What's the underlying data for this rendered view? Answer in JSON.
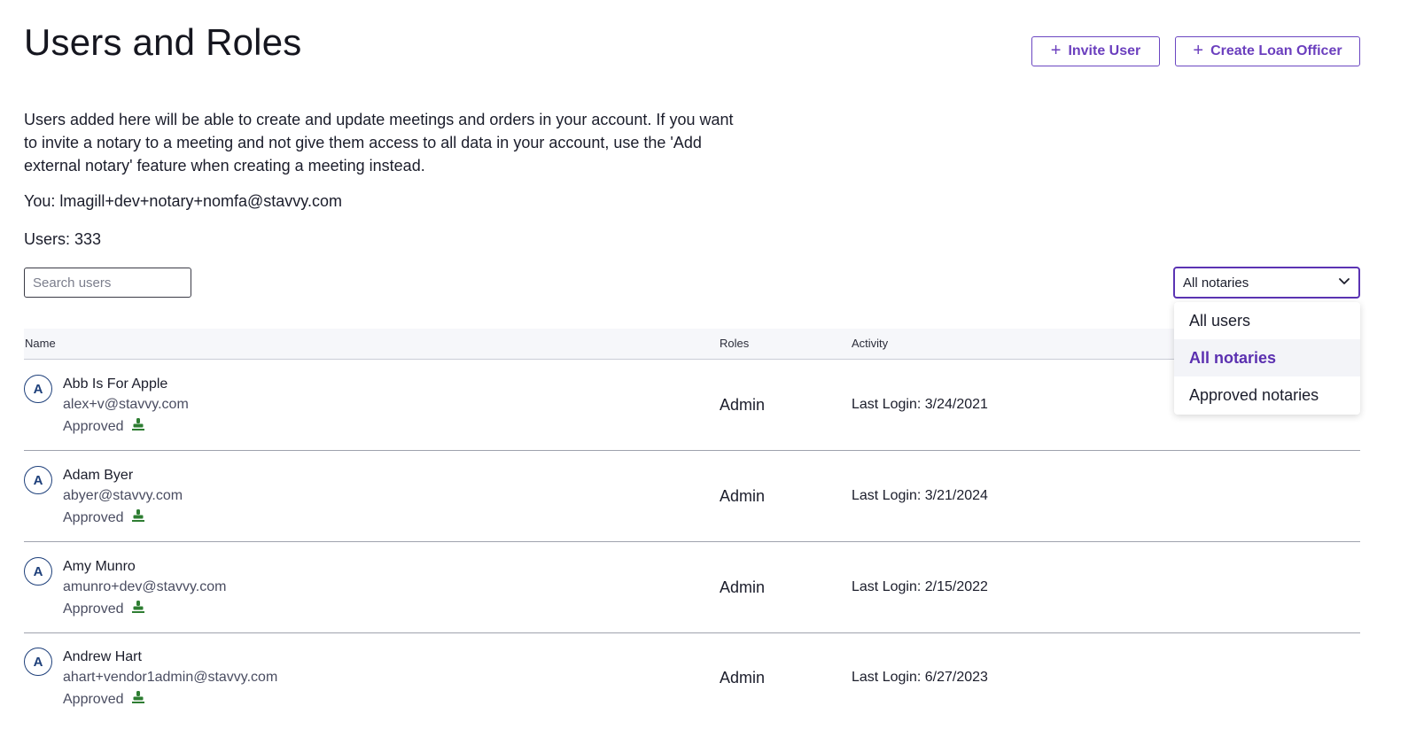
{
  "page": {
    "title": "Users and Roles",
    "description": "Users added here will be able to create and update meetings and orders in your account. If you want to invite a notary to a meeting and not give them access to all data in your account, use the 'Add external notary' feature when creating a meeting instead.",
    "you_line": "You: lmagill+dev+notary+nomfa@stavvy.com",
    "users_count": "Users: 333"
  },
  "buttons": {
    "invite_user": "Invite User",
    "create_loan_officer": "Create Loan Officer"
  },
  "search": {
    "placeholder": "Search users",
    "value": ""
  },
  "filter": {
    "selected": "All notaries",
    "options": [
      "All users",
      "All notaries",
      "Approved notaries"
    ]
  },
  "table": {
    "headers": {
      "name": "Name",
      "roles": "Roles",
      "activity": "Activity"
    },
    "rows": [
      {
        "initial": "A",
        "name": "Abb Is For Apple",
        "email": "alex+v@stavvy.com",
        "status": "Approved",
        "role": "Admin",
        "activity": "Last Login: 3/24/2021"
      },
      {
        "initial": "A",
        "name": "Adam Byer",
        "email": "abyer@stavvy.com",
        "status": "Approved",
        "role": "Admin",
        "activity": "Last Login: 3/21/2024"
      },
      {
        "initial": "A",
        "name": "Amy Munro",
        "email": "amunro+dev@stavvy.com",
        "status": "Approved",
        "role": "Admin",
        "activity": "Last Login: 2/15/2022"
      },
      {
        "initial": "A",
        "name": "Andrew Hart",
        "email": "ahart+vendor1admin@stavvy.com",
        "status": "Approved",
        "role": "Admin",
        "activity": "Last Login: 6/27/2023"
      }
    ]
  },
  "colors": {
    "accent": "#6b46c1",
    "avatar": "#1d3f7a",
    "stamp_icon": "#2e7d32"
  },
  "icons": {
    "plus": "plus-icon",
    "chevron": "chevron-down-icon",
    "stamp": "notary-stamp-icon"
  }
}
